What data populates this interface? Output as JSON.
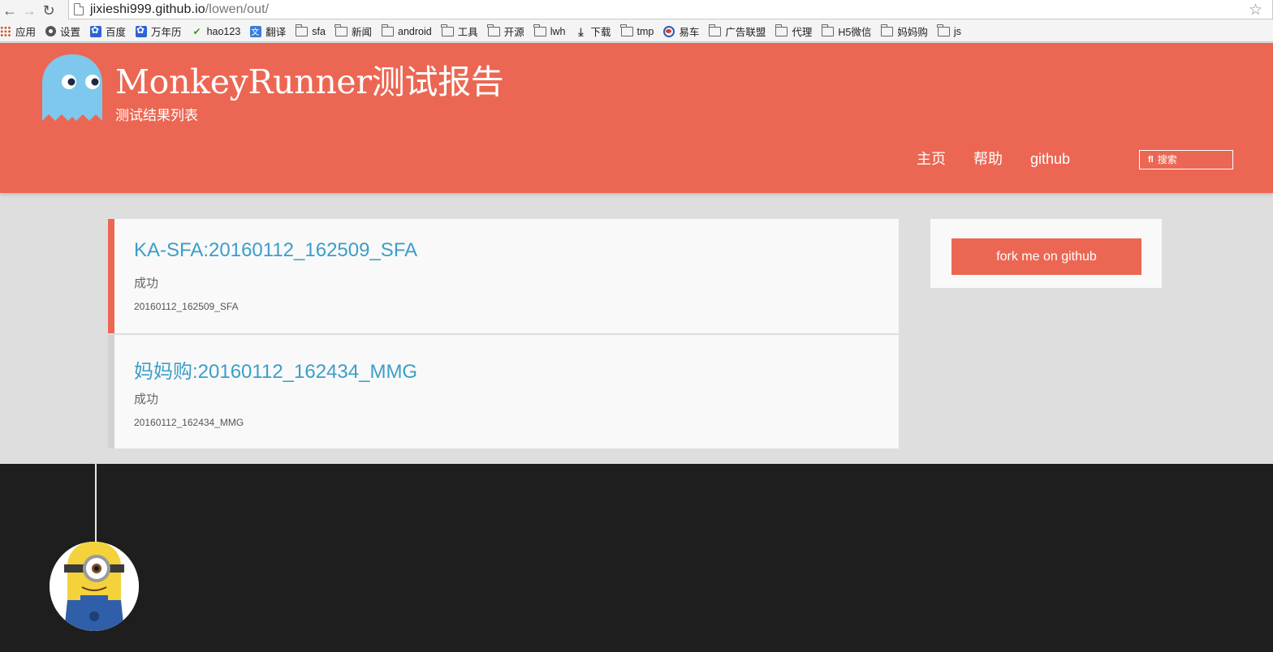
{
  "browser": {
    "url_host": "jixieshi999.github.io",
    "url_path": "/lowen/out/",
    "back_icon": "back-arrow-icon",
    "forward_icon": "forward-arrow-icon",
    "reload_icon": "reload-icon",
    "star_icon": "bookmark-star-icon"
  },
  "bookmarks": [
    {
      "label": "应用",
      "icon": "apps-icon"
    },
    {
      "label": "设置",
      "icon": "gear-icon"
    },
    {
      "label": "百度",
      "icon": "baidu-paw-icon"
    },
    {
      "label": "万年历",
      "icon": "baidu-paw-icon"
    },
    {
      "label": "hao123",
      "icon": "hao123-icon"
    },
    {
      "label": "翻译",
      "icon": "translate-icon"
    },
    {
      "label": "sfa",
      "icon": "folder-icon"
    },
    {
      "label": "新闻",
      "icon": "folder-icon"
    },
    {
      "label": "android",
      "icon": "folder-icon"
    },
    {
      "label": "工具",
      "icon": "folder-icon"
    },
    {
      "label": "开源",
      "icon": "folder-icon"
    },
    {
      "label": "lwh",
      "icon": "folder-icon"
    },
    {
      "label": "下载",
      "icon": "download-icon"
    },
    {
      "label": "tmp",
      "icon": "folder-icon"
    },
    {
      "label": "易车",
      "icon": "yiche-icon"
    },
    {
      "label": "广告联盟",
      "icon": "folder-icon"
    },
    {
      "label": "代理",
      "icon": "folder-icon"
    },
    {
      "label": "H5微信",
      "icon": "folder-icon"
    },
    {
      "label": "妈妈购",
      "icon": "folder-icon"
    },
    {
      "label": "js",
      "icon": "folder-icon"
    }
  ],
  "header": {
    "title": "MonkeyRunner测试报告",
    "subtitle": "测试结果列表",
    "nav": [
      "主页",
      "帮助",
      "github"
    ],
    "search_placeholder": "搜索",
    "search_icon": "search-icon",
    "logo_icon": "ghost-logo-icon",
    "accent_color": "#ec6753"
  },
  "posts": [
    {
      "title": "KA-SFA:20160112_162509_SFA",
      "status": "成功",
      "meta": "20160112_162509_SFA"
    },
    {
      "title": "妈妈购:20160112_162434_MMG",
      "status": "成功",
      "meta": "20160112_162434_MMG"
    }
  ],
  "sidebar": {
    "fork_label": "fork me on github"
  },
  "footer": {
    "avatar_icon": "minion-avatar-icon"
  }
}
